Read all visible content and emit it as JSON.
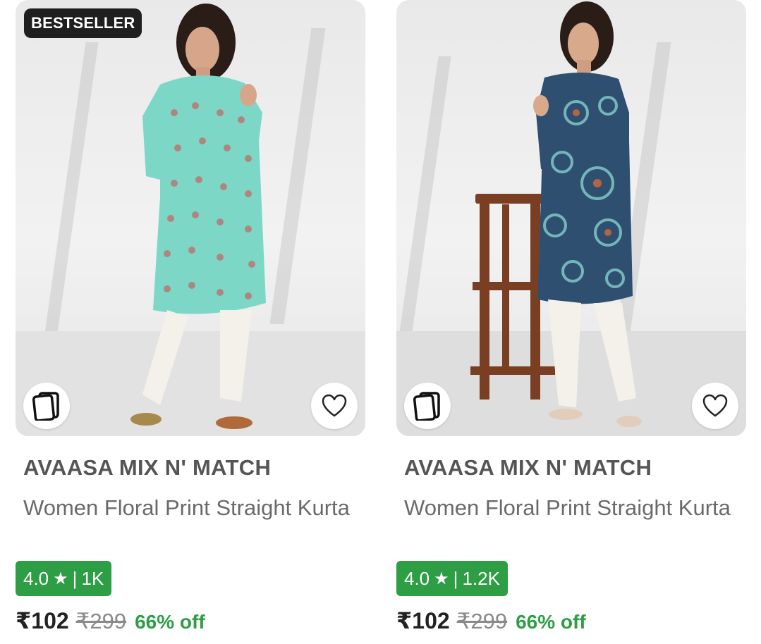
{
  "products": [
    {
      "badge": "BESTSELLER",
      "brand": "AVAASA MIX N' MATCH",
      "title": "Women Floral Print Straight Kurta",
      "rating": "4.0",
      "rating_sep": "|",
      "rating_count": "1K",
      "price": "₹102",
      "mrp": "₹299",
      "discount": "66% off",
      "kurta_color": "#7dd7c6",
      "print_color": "#c06a6a"
    },
    {
      "brand": "AVAASA MIX N' MATCH",
      "title": "Women Floral Print Straight Kurta",
      "rating": "4.0",
      "rating_sep": "|",
      "rating_count": "1.2K",
      "price": "₹102",
      "mrp": "₹299",
      "discount": "66% off",
      "kurta_color": "#2f4f70",
      "print_color": "#7fc7c7"
    }
  ],
  "colors": {
    "rating_bg": "#2e9e44",
    "discount": "#2e9e44",
    "badge_bg": "#1f1f1f"
  },
  "icons": {
    "similar": "similar-products-icon",
    "wishlist": "heart-icon",
    "star": "star-icon"
  }
}
